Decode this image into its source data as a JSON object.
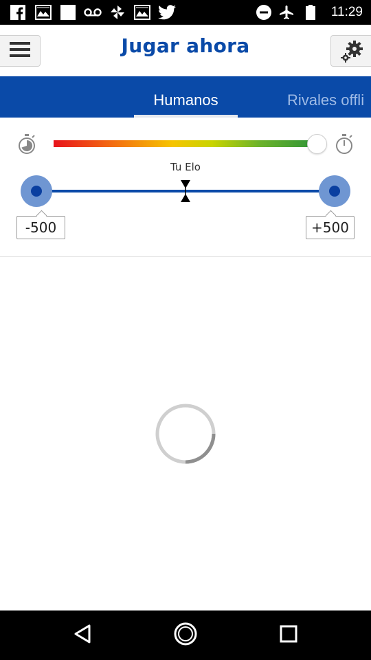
{
  "status_bar": {
    "time": "11:29",
    "left_icons": [
      "facebook-icon",
      "gallery-icon",
      "image-icon",
      "voicemail-icon",
      "pinwheel-icon",
      "gallery-icon",
      "twitter-icon"
    ],
    "right_icons": [
      "do-not-disturb-icon",
      "airplane-mode-icon",
      "battery-icon"
    ]
  },
  "header": {
    "title": "Jugar ahora",
    "menu_icon": "hamburger-menu-icon",
    "settings_icon": "gears-icon"
  },
  "tabs": [
    {
      "label": "Humanos",
      "active": true
    },
    {
      "label": "Rivales offli",
      "active": false
    }
  ],
  "time_control": {
    "left_icon": "stopwatch-fast-icon",
    "right_icon": "stopwatch-icon",
    "value": 1.0,
    "gradient_colors": [
      "#e8141c",
      "#f36b12",
      "#f6c400",
      "#c9d400",
      "#6cb32a",
      "#2e9438"
    ]
  },
  "elo_range": {
    "label": "Tu Elo",
    "min_label": "-500",
    "max_label": "+500",
    "min": -500,
    "max": 500
  },
  "loading": {
    "icon": "loading-spinner-icon"
  },
  "nav_bar": {
    "back_icon": "back-triangle-icon",
    "home_icon": "home-circle-icon",
    "recents_icon": "recents-square-icon"
  },
  "colors": {
    "brand_blue": "#0a4aa8",
    "handle_light": "#6f96d2",
    "handle_dark": "#0a3fa0",
    "inactive_tab": "#9fbbe6"
  }
}
